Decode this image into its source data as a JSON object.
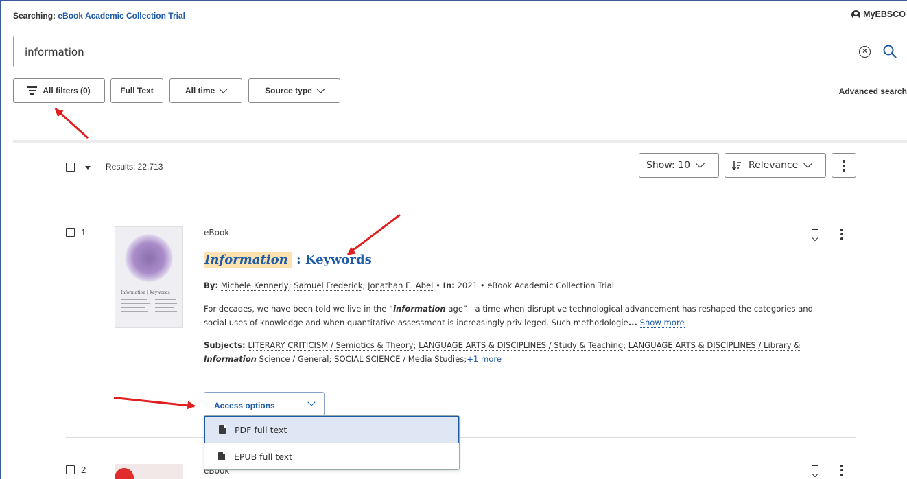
{
  "header": {
    "searching_label": "Searching:",
    "database": "eBook Academic Collection Trial",
    "account_label": "MyEBSCO"
  },
  "search": {
    "query": "information"
  },
  "filters": {
    "all_filters": "All filters (0)",
    "full_text": "Full Text",
    "all_time": "All time",
    "source_type": "Source type",
    "advanced_search": "Advanced search"
  },
  "results_bar": {
    "count": "Results: 22,713",
    "show": "Show: 10",
    "sort": "Relevance"
  },
  "results": [
    {
      "number": "1",
      "type": "eBook",
      "title_highlight": "Information",
      "title_rest": " : Keywords",
      "by_label": "By:",
      "authors": [
        "Michele Kennerly",
        "Samuel Frederick",
        "Jonathan E. Abel"
      ],
      "in_label": "In:",
      "year": "2021",
      "collection": "eBook Academic Collection Trial",
      "abstract_pre": "For decades, we have been told we live in the “",
      "abstract_hl": "information",
      "abstract_post": " age”—a time when disruptive technological advancement has reshaped the categories and social uses of knowledge and when quantitative assessment is increasingly privileged. Such methodologie",
      "ellipsis": "...",
      "show_more": "Show more",
      "subjects_label": "Subjects:",
      "subject1": "LITERARY CRITICISM / Semiotics & Theory",
      "subject2": "LANGUAGE ARTS & DISCIPLINES / Study & Teaching",
      "subject3_pre": "LANGUAGE ARTS & DISCIPLINES / Library & ",
      "subject3_hl": "Information",
      "subject3_post": " Science / General",
      "subject4": "SOCIAL SCIENCE / Media Studies",
      "plus_more": "+1 more",
      "cover_title": "Information",
      "cover_sub": "Keywords"
    },
    {
      "number": "2",
      "type": "eBook"
    }
  ],
  "access": {
    "label": "Access options",
    "options": [
      "PDF full text",
      "EPUB full text"
    ]
  },
  "colors": {
    "link": "#1d5aa8",
    "highlight": "#fde2b0",
    "annotation_arrow": "#e02020",
    "menu_selected": "#dfe6f4"
  }
}
